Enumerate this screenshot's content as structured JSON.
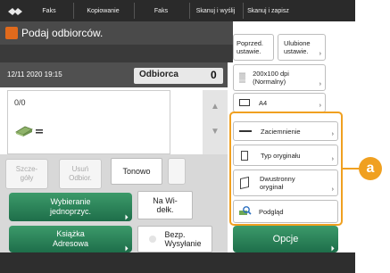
{
  "topbar": {
    "tabs": [
      "Faks",
      "Kopiowanie",
      "Faks",
      "Skanuj i wyślij",
      "Skanuj i zapisz"
    ]
  },
  "header": {
    "title": "Podaj odbiorców."
  },
  "status": {
    "datetime": "12/11 2020 19:15",
    "destination_label": "Odbiorca",
    "destination_count": "0"
  },
  "list": {
    "count": "0/0"
  },
  "panel": {
    "details_label_1": "Szcze-",
    "details_label_2": "góły",
    "delete_label_1": "Usuń",
    "delete_label_2": "Odbior.",
    "tone_label": "Tonowo",
    "onetouch_label_1": "Wybieranie",
    "onetouch_label_2": "jednoprzyc.",
    "onhook_label_1": "Na Wi-",
    "onhook_label_2": "dełk.",
    "addressbook_label_1": "Książka",
    "addressbook_label_2": "Adresowa",
    "direct_label_1": "Bezp.",
    "direct_label_2": "Wysyłanie"
  },
  "right": {
    "prev_settings_1": "Poprzed.",
    "prev_settings_2": "ustawie.",
    "fav_settings_1": "Ulubione",
    "fav_settings_2": "ustawie.",
    "resolution_1": "200x100 dpi",
    "resolution_2": "(Normalny)",
    "size": "A4",
    "darkness": "Zaciemnienie",
    "original_type": "Typ oryginału",
    "duplex_1": "Dwustronny",
    "duplex_2": "oryginał",
    "preview": "Podgląd",
    "options": "Opcje"
  },
  "callout": {
    "label": "a"
  },
  "colors": {
    "accent_orange": "#f0a020",
    "green_button": "#2b8456",
    "header_icon": "#e06a1c"
  }
}
